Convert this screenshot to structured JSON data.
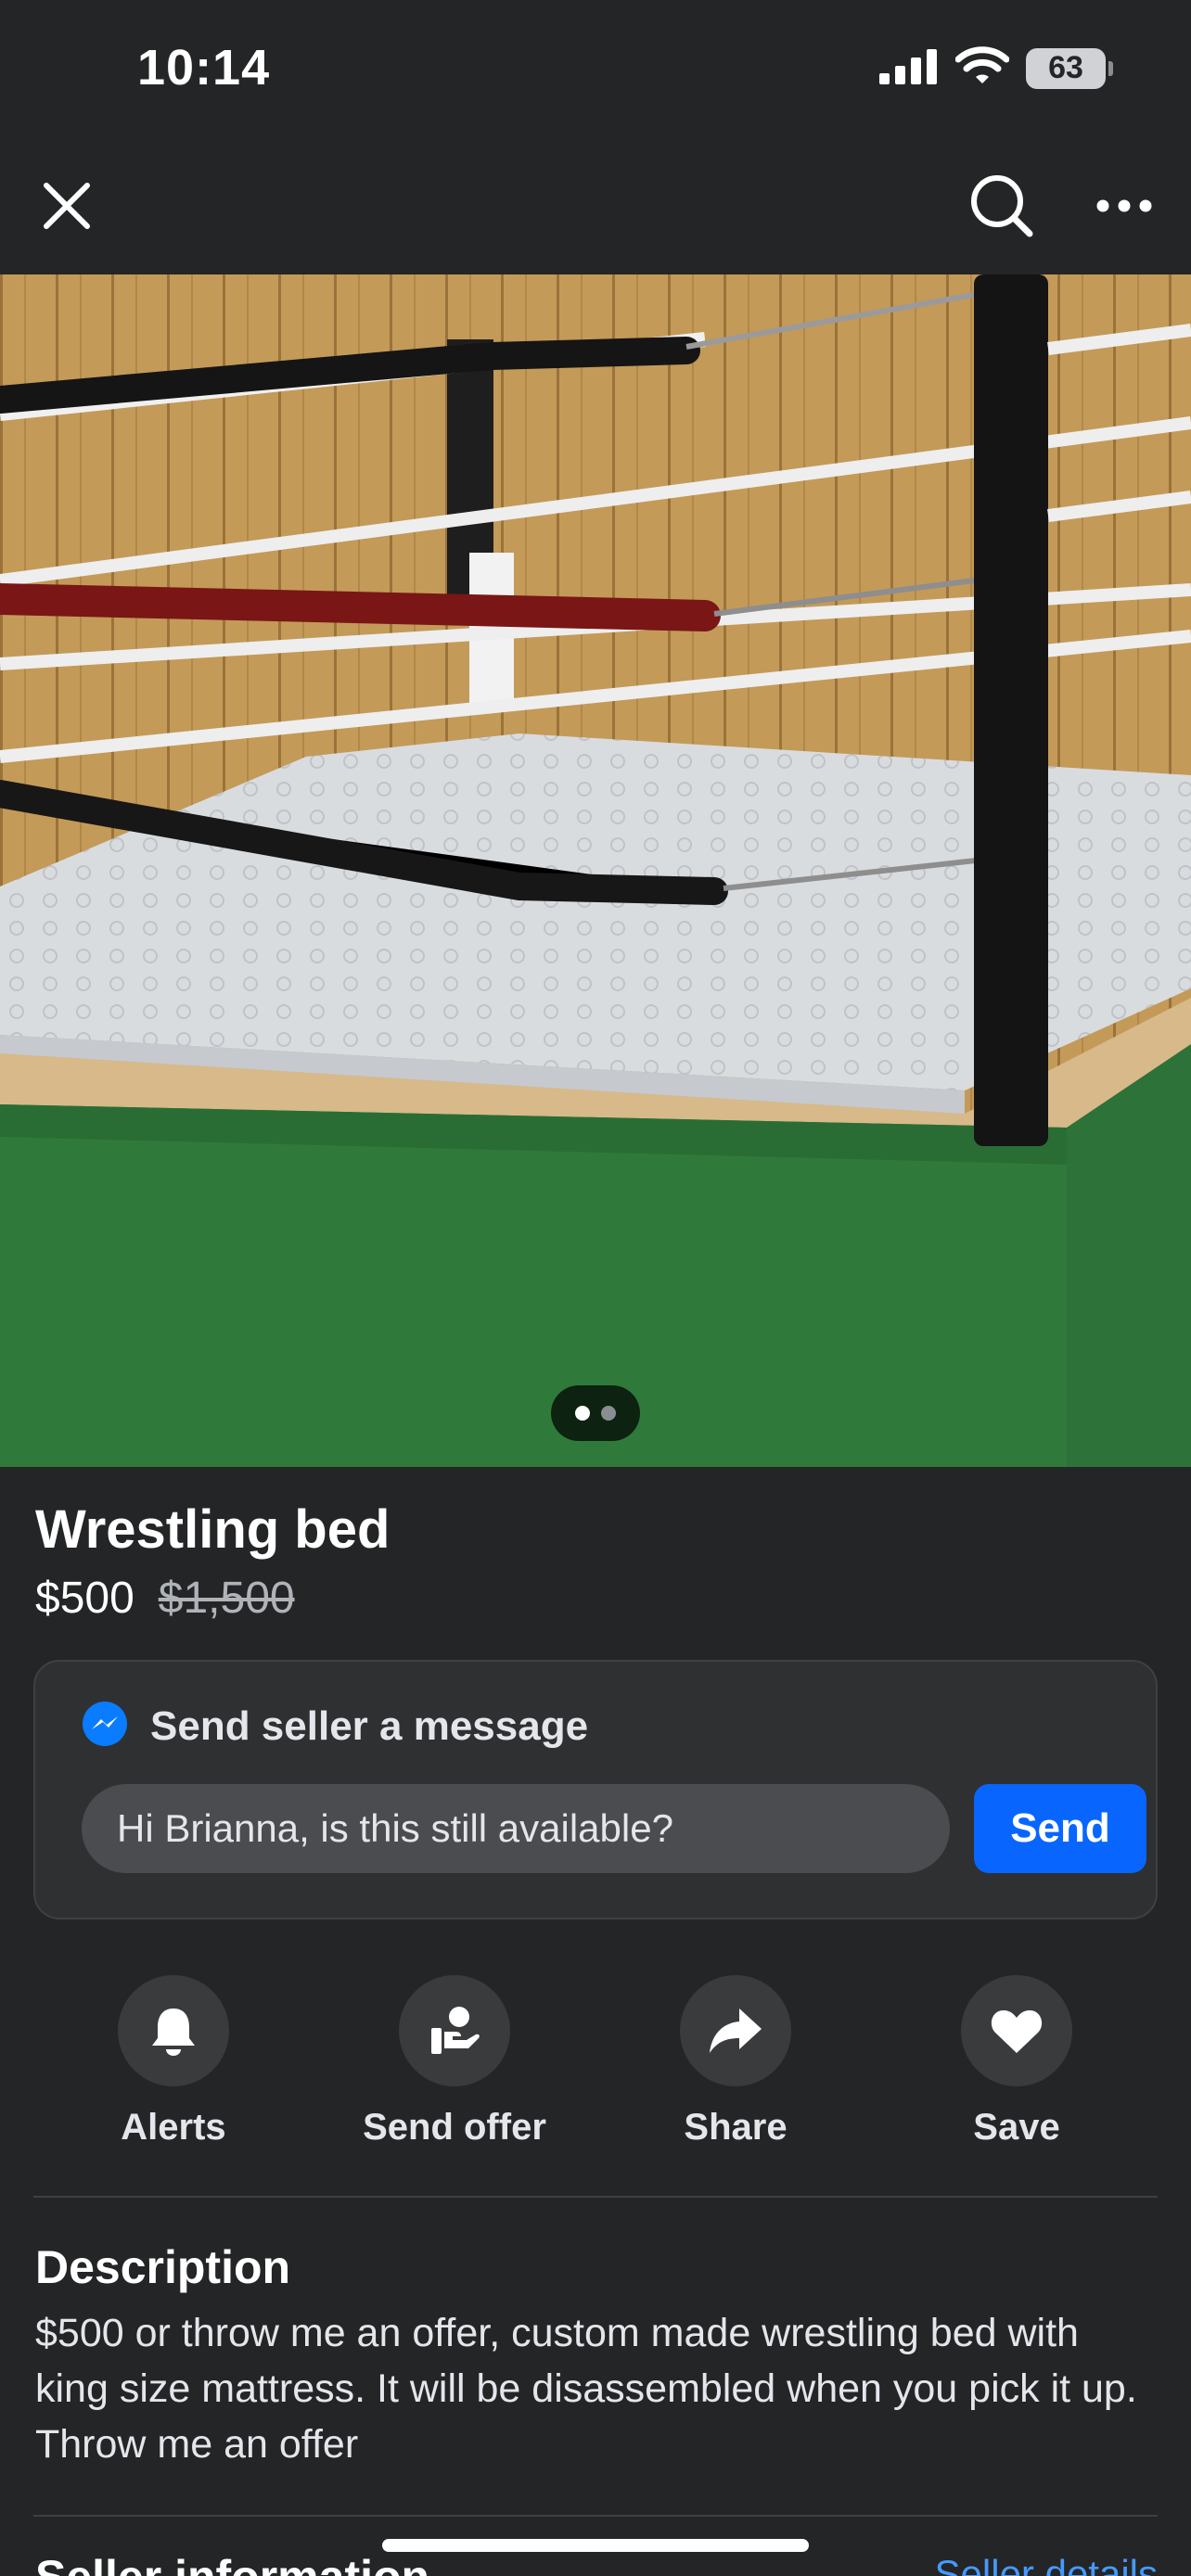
{
  "status_bar": {
    "time": "10:14",
    "battery": "63"
  },
  "nav": {
    "close_icon": "close-icon",
    "search_icon": "search-icon",
    "more_icon": "more-icon"
  },
  "photo": {
    "description_icon": "listing-photo",
    "page_count": 2,
    "current_page": 1
  },
  "listing": {
    "title": "Wrestling bed",
    "price": "$500",
    "original_price": "$1,500"
  },
  "message": {
    "header": "Send seller a message",
    "input_value": "Hi Brianna, is this still available?",
    "send_label": "Send",
    "accent": "#0866ff"
  },
  "actions": [
    {
      "label": "Alerts",
      "icon": "bell-icon"
    },
    {
      "label": "Send offer",
      "icon": "send-offer-icon"
    },
    {
      "label": "Share",
      "icon": "share-icon"
    },
    {
      "label": "Save",
      "icon": "heart-icon"
    }
  ],
  "description": {
    "heading": "Description",
    "body": "$500 or throw me an offer, custom made wrestling bed with king size mattress. It will be disassembled when you pick it up. Throw me an offer"
  },
  "seller": {
    "heading": "Seller information",
    "link": "Seller details"
  }
}
